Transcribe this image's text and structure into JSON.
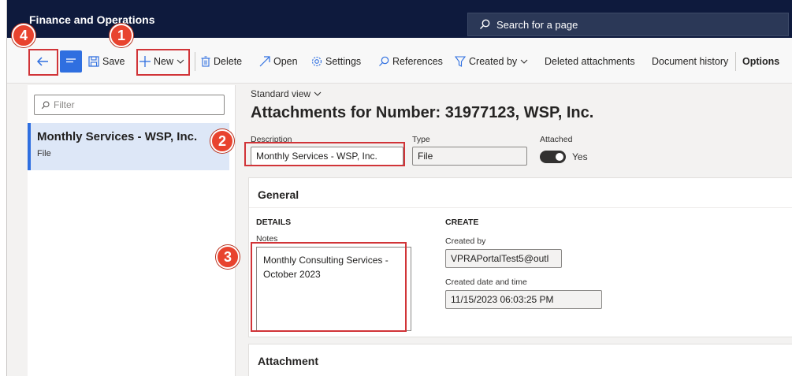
{
  "app": {
    "title": "Finance and Operations"
  },
  "search": {
    "placeholder": "Search for a page"
  },
  "toolbar": {
    "save": "Save",
    "new": "New",
    "delete": "Delete",
    "open": "Open",
    "settings": "Settings",
    "references": "References",
    "created_by": "Created by",
    "deleted_attachments": "Deleted attachments",
    "document_history": "Document history",
    "options": "Options"
  },
  "list": {
    "filter_placeholder": "Filter",
    "items": [
      {
        "title": "Monthly Services - WSP, Inc.",
        "subtitle": "File"
      }
    ]
  },
  "form": {
    "view": "Standard view",
    "title": "Attachments for Number: 31977123, WSP, Inc.",
    "description_label": "Description",
    "description_value": "Monthly Services - WSP, Inc.",
    "type_label": "Type",
    "type_value": "File",
    "attached_label": "Attached",
    "attached_value": "Yes",
    "attached_on": true
  },
  "general": {
    "header": "General",
    "details_group": "DETAILS",
    "notes_label": "Notes",
    "notes_value": "Monthly Consulting Services - October 2023",
    "create_group": "CREATE",
    "created_by_label": "Created by",
    "created_by_value": "VPRAPortalTest5@outl",
    "created_dt_label": "Created date and time",
    "created_dt_value": "11/15/2023 06:03:25 PM"
  },
  "attachment": {
    "header": "Attachment"
  },
  "annotations": {
    "n1": "1",
    "n2": "2",
    "n3": "3",
    "n4": "4"
  },
  "colors": {
    "nav": "#0e1a3d",
    "accent": "#2f6fe0",
    "annotation": "#d13438"
  }
}
